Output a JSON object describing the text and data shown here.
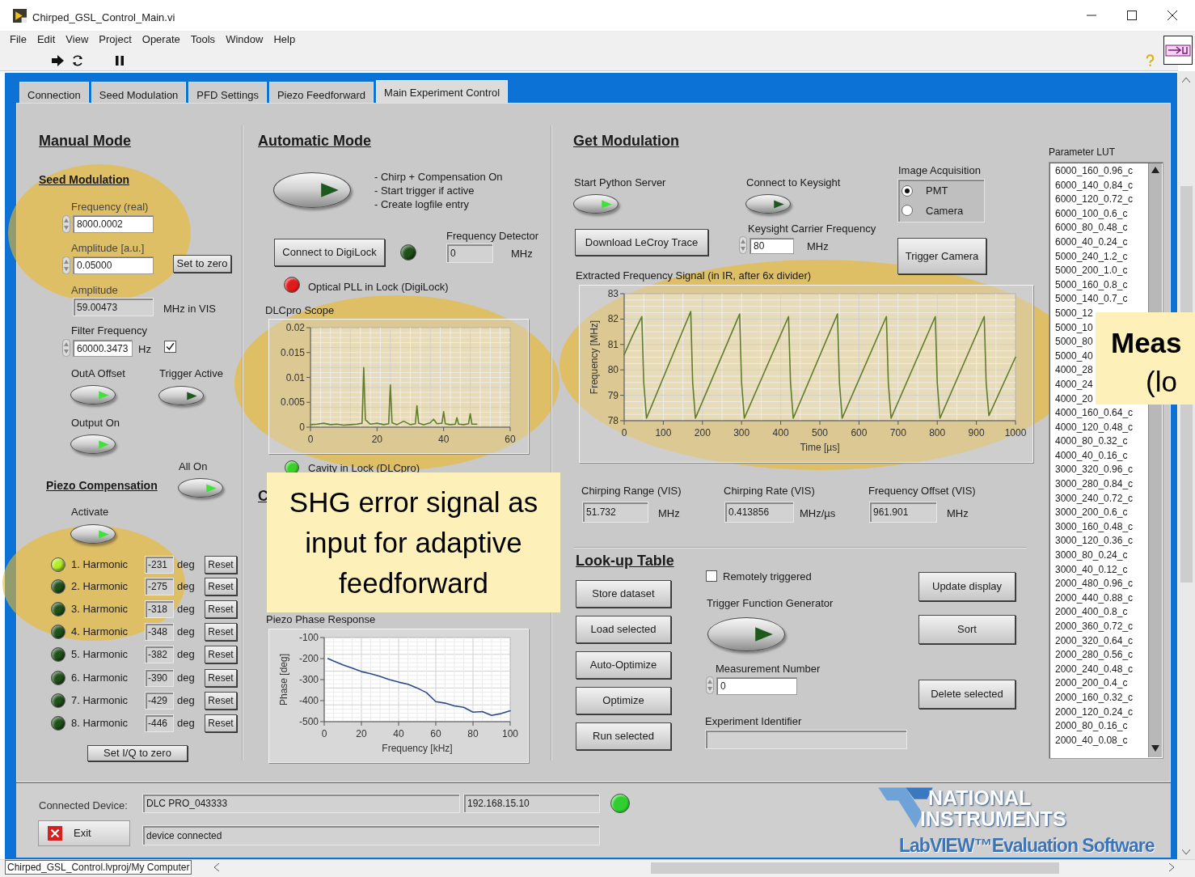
{
  "window": {
    "title": "Chirped_GSL_Control_Main.vi"
  },
  "menu": [
    "File",
    "Edit",
    "View",
    "Project",
    "Operate",
    "Tools",
    "Window",
    "Help"
  ],
  "tabs": [
    {
      "label": "Connection",
      "selected": false
    },
    {
      "label": "Seed Modulation",
      "selected": false
    },
    {
      "label": "PFD Settings",
      "selected": false
    },
    {
      "label": "Piezo Feedforward",
      "selected": false
    },
    {
      "label": "Main Experiment Control",
      "selected": true
    }
  ],
  "manual_mode": {
    "heading": "Manual Mode",
    "seed_heading": "Seed Modulation",
    "frequency_real": {
      "label": "Frequency (real)",
      "value": "8000.0002"
    },
    "amplitude_au": {
      "label": "Amplitude [a.u.]",
      "value": "0.05000"
    },
    "set_to_zero": "Set to zero",
    "amplitude": {
      "label": "Amplitude",
      "value": "59.00473",
      "unit": "MHz in VIS"
    },
    "filter_frequency": {
      "label": "Filter Frequency",
      "value": "60000.3473",
      "unit": "Hz",
      "checked": true
    },
    "switches": [
      {
        "label": "OutA Offset",
        "on": true
      },
      {
        "label": "Trigger Active",
        "on": false
      },
      {
        "label": "Output On",
        "on": true
      }
    ]
  },
  "piezo_compensation": {
    "heading": "Piezo Compensation",
    "all_on": {
      "label": "All On",
      "on": true
    },
    "activate": {
      "label": "Activate",
      "on": true
    },
    "harmonics": [
      {
        "label": "1. Harmonic",
        "value": "-231",
        "unit": "deg",
        "button": "Reset",
        "on": true
      },
      {
        "label": "2. Harmonic",
        "value": "-275",
        "unit": "deg",
        "button": "Reset",
        "on": false
      },
      {
        "label": "3. Harmonic",
        "value": "-318",
        "unit": "deg",
        "button": "Reset",
        "on": false
      },
      {
        "label": "4. Harmonic",
        "value": "-348",
        "unit": "deg",
        "button": "Reset",
        "on": false
      },
      {
        "label": "5. Harmonic",
        "value": "-382",
        "unit": "deg",
        "button": "Reset",
        "on": false
      },
      {
        "label": "6. Harmonic",
        "value": "-390",
        "unit": "deg",
        "button": "Reset",
        "on": false
      },
      {
        "label": "7. Harmonic",
        "value": "-429",
        "unit": "deg",
        "button": "Reset",
        "on": false
      },
      {
        "label": "8. Harmonic",
        "value": "-446",
        "unit": "deg",
        "button": "Reset",
        "on": false
      }
    ],
    "set_iq_zero": "Set I/Q to zero"
  },
  "automatic_mode": {
    "heading": "Automatic Mode",
    "switch_on": false,
    "notes": [
      "- Chirp + Compensation On",
      "- Start trigger if active",
      "- Create logfile entry"
    ],
    "connect_button": "Connect to DigiLock",
    "digilock_on": false,
    "frequency_detector": {
      "label": "Frequency Detector",
      "value": "0",
      "unit": "MHz"
    },
    "pll_lock": {
      "label": "Optical PLL in Lock (DigiLock)",
      "on": true
    },
    "scope": {
      "chart_data": {
        "type": "line",
        "title": "DLCpro Scope",
        "x": [
          0,
          2,
          4,
          6,
          8,
          10,
          12,
          14,
          15.5,
          16,
          16.5,
          18,
          20,
          22,
          23.5,
          24,
          24.5,
          26,
          28,
          30,
          31.5,
          32,
          32.5,
          34,
          36,
          37,
          38,
          39.5,
          40,
          40.5,
          42,
          43.5,
          44,
          44.5,
          46,
          47.5,
          48,
          48.5,
          50
        ],
        "values": [
          0.0005,
          0.0006,
          0.0008,
          0.0005,
          0.0006,
          0.0004,
          0.0005,
          0.0006,
          0.0008,
          0.012,
          0.0015,
          0.0006,
          0.0008,
          0.0005,
          0.0007,
          0.0085,
          0.0009,
          0.0005,
          0.0012,
          0.0005,
          0.0007,
          0.0043,
          0.0008,
          0.0005,
          0.0009,
          0.0016,
          0.0007,
          0.0008,
          0.0031,
          0.0007,
          0.0005,
          0.0006,
          0.0019,
          0.0006,
          0.0005,
          0.0007,
          0.0027,
          0.0006,
          0.0006
        ],
        "xlim": [
          0,
          60
        ],
        "ylim": [
          0,
          0.02
        ],
        "grid": true,
        "xticks": [
          0,
          20,
          40,
          60
        ],
        "yticks": [
          0,
          0.005,
          0.01,
          0.015,
          0.02
        ]
      }
    },
    "cavity_lock": {
      "label": "Cavity in Lock (DLCpro)",
      "on": true
    },
    "partial_heading": "C",
    "phase": {
      "chart_data": {
        "type": "line",
        "title": "Piezo Phase Response",
        "xlabel": "Frequency [kHz]",
        "ylabel": "Phase [deg]",
        "x": [
          2,
          5,
          10,
          15,
          20,
          25,
          30,
          35,
          40,
          45,
          50,
          55,
          60,
          65,
          70,
          75,
          80,
          85,
          90,
          95,
          100
        ],
        "values": [
          -200,
          -212,
          -230,
          -245,
          -262,
          -272,
          -285,
          -300,
          -312,
          -322,
          -340,
          -362,
          -405,
          -412,
          -425,
          -432,
          -455,
          -452,
          -470,
          -462,
          -448
        ],
        "xlim": [
          0,
          100
        ],
        "ylim": [
          -500,
          -100
        ],
        "grid": true,
        "xticks": [
          0,
          20,
          40,
          60,
          80,
          100
        ],
        "yticks": [
          -500,
          -400,
          -300,
          -200,
          -100
        ]
      }
    }
  },
  "get_modulation": {
    "heading": "Get Modulation",
    "python_server": {
      "label": "Start Python Server",
      "on": true
    },
    "keysight": {
      "label": "Connect to Keysight",
      "on": false
    },
    "image_acquisition": {
      "label": "Image Acquisition",
      "options": [
        {
          "label": "PMT",
          "selected": true
        },
        {
          "label": "Camera",
          "selected": false
        }
      ]
    },
    "download_button": "Download LeCroy Trace",
    "carrier": {
      "label": "Keysight Carrier Frequency",
      "value": "80",
      "unit": "MHz"
    },
    "trigger_camera": "Trigger Camera",
    "signal": {
      "chart_data": {
        "type": "line",
        "title": "Extracted Frequency Signal (in IR, after 6x divider)",
        "xlabel": "Time [µs]",
        "ylabel": "Frequency [MHz]",
        "x": [
          0,
          20,
          45,
          50,
          57,
          170,
          175,
          182,
          295,
          300,
          307,
          420,
          425,
          432,
          545,
          550,
          557,
          670,
          675,
          682,
          795,
          800,
          807,
          920,
          925,
          932,
          1000
        ],
        "values": [
          80.6,
          81.3,
          82.1,
          79.5,
          78.1,
          82.3,
          79.5,
          78.1,
          82.2,
          79.5,
          78.1,
          82.1,
          79.5,
          78.1,
          82.2,
          79.5,
          78.1,
          82.1,
          79.5,
          78.1,
          82.1,
          79.5,
          78.1,
          82.1,
          79.5,
          78.2,
          80.5
        ],
        "xlim": [
          0,
          1000
        ],
        "ylim": [
          78,
          83
        ],
        "grid": true,
        "xticks": [
          0,
          100,
          200,
          300,
          400,
          500,
          600,
          700,
          800,
          900,
          1000
        ],
        "yticks": [
          78,
          79,
          80,
          81,
          82,
          83
        ]
      }
    },
    "chirping_range": {
      "label": "Chirping Range (VIS)",
      "value": "51.732",
      "unit": "MHz"
    },
    "chirping_rate": {
      "label": "Chirping Rate (VIS)",
      "value": "0.413856",
      "unit": "MHz/µs"
    },
    "frequency_offset": {
      "label": "Frequency Offset (VIS)",
      "value": "961.901",
      "unit": "MHz"
    }
  },
  "lookup_table": {
    "heading": "Look-up Table",
    "buttons": [
      "Store dataset",
      "Load selected",
      "Auto-Optimize",
      "Optimize",
      "Run selected"
    ],
    "remotely_triggered": {
      "label": "Remotely triggered",
      "checked": false
    },
    "function_generator": {
      "label": "Trigger Function Generator",
      "on": false
    },
    "measurement_number": {
      "label": "Measurement Number",
      "value": "0"
    },
    "experiment_identifier": {
      "label": "Experiment Identifier"
    },
    "right_buttons": [
      "Update display",
      "Sort",
      "Delete selected"
    ]
  },
  "parameter_lut": {
    "label": "Parameter LUT",
    "items": [
      "6000_160_0.96_c",
      "6000_140_0.84_c",
      "6000_120_0.72_c",
      "6000_100_0.6_c",
      "6000_80_0.48_c",
      "6000_40_0.24_c",
      "5000_240_1.2_c",
      "5000_200_1.0_c",
      "5000_160_0.8_c",
      "5000_140_0.7_c",
      "5000_12",
      "5000_10",
      "5000_80",
      "5000_40",
      "4000_28",
      "4000_24",
      "4000_20",
      "4000_160_0.64_c",
      "4000_120_0.48_c",
      "4000_80_0.32_c",
      "4000_40_0.16_c",
      "3000_320_0.96_c",
      "3000_280_0.84_c",
      "3000_240_0.72_c",
      "3000_200_0.6_c",
      "3000_160_0.48_c",
      "3000_120_0.36_c",
      "3000_80_0.24_c",
      "3000_40_0.12_c",
      "2000_480_0.96_c",
      "2000_440_0.88_c",
      "2000_400_0.8_c",
      "2000_360_0.72_c",
      "2000_320_0.64_c",
      "2000_280_0.56_c",
      "2000_240_0.48_c",
      "2000_200_0.4_c",
      "2000_160_0.32_c",
      "2000_120_0.24_c",
      "2000_80_0.16_c",
      "2000_40_0.08_c"
    ]
  },
  "footer": {
    "device_label": "Connected Device:",
    "device": "DLC PRO_043333",
    "address": "192.168.15.10",
    "connected": true,
    "exit_button": "Exit",
    "status": "device connected"
  },
  "logo": {
    "lines": [
      "NATIONAL",
      "INSTRUMENTS",
      "LabVIEW™Evaluation Software"
    ]
  },
  "status_bar": {
    "path": "Chirped_GSL_Control.lvproj/My Computer"
  },
  "callouts": [
    {
      "lines": [
        "SHG error signal as input for adaptive feedforward"
      ]
    },
    {
      "lines": [
        "Meas",
        "(lo"
      ]
    }
  ]
}
